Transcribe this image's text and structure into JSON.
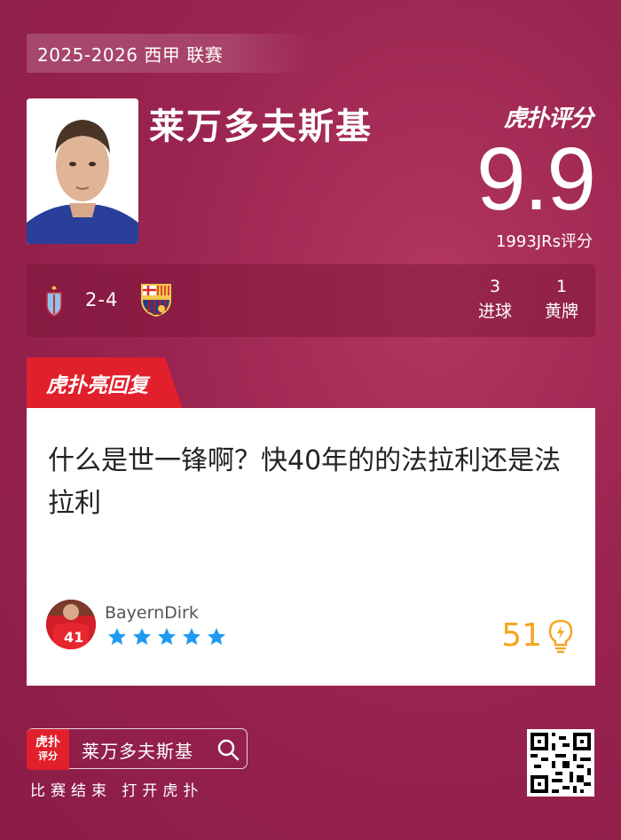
{
  "header": {
    "season": "2025-2026 西甲 联赛"
  },
  "player": {
    "name": "莱万多夫斯基"
  },
  "rating": {
    "brand": "虎扑评分",
    "value": "9.9",
    "count_text": "1993JRs评分"
  },
  "match": {
    "score": "2-4",
    "stats": [
      {
        "value": "3",
        "label": "进球"
      },
      {
        "value": "1",
        "label": "黄牌"
      }
    ]
  },
  "reply": {
    "tab_label": "虎扑亮回复",
    "text": "什么是世一锋啊？快40年的的法拉利还是法拉利",
    "username": "BayernDirk",
    "stars": 5,
    "likes": "51"
  },
  "footer": {
    "app_logo": "虎扑",
    "app_logo_sub": "评分",
    "search_text": "莱万多夫斯基",
    "caption": "比赛结束 打开虎扑"
  },
  "colors": {
    "background": "#9a2450",
    "accent_red": "#e1202c",
    "like_color": "#f5a623",
    "star_color": "#1e9bf0"
  }
}
